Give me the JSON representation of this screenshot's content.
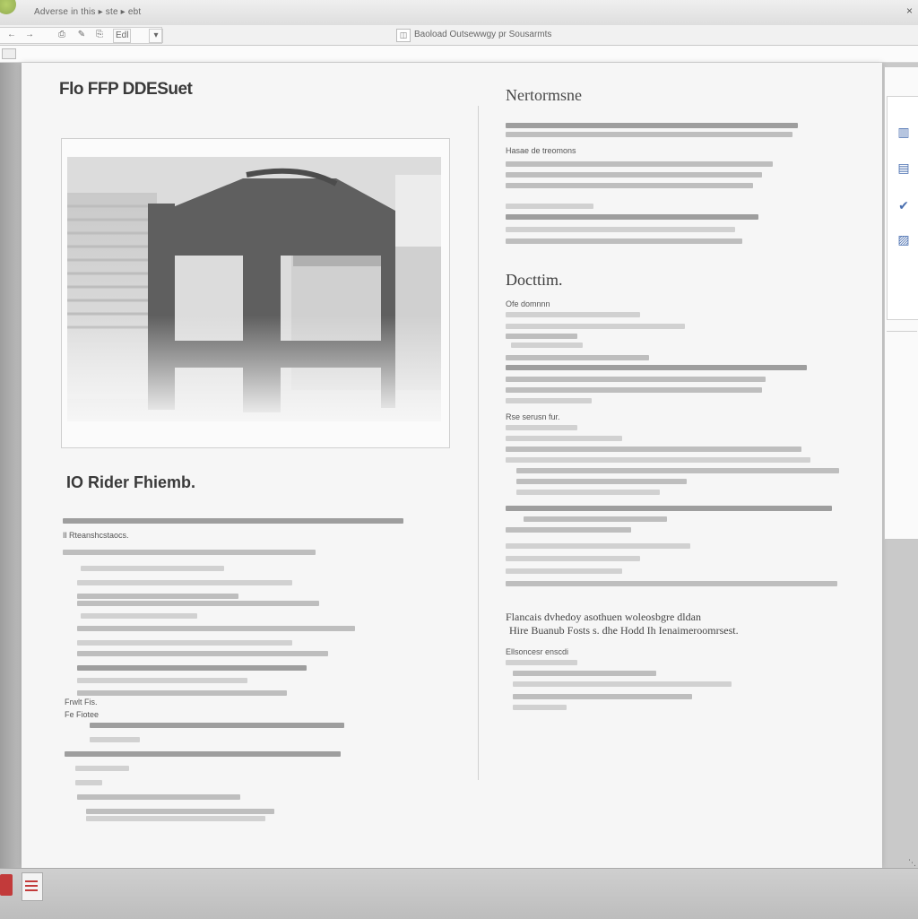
{
  "window": {
    "title": "Adverse in this    ▸ ste  ▸ ebt",
    "address": "Baoload Outsewwgy pr Sousarmts",
    "address_icon": "◫",
    "close_glyph": "×",
    "toolbar": [
      "←",
      "→",
      "⎙",
      "✎",
      "⎘",
      "Edl",
      "▾"
    ]
  },
  "document": {
    "title": "Flo FFP DDESuet",
    "section_left": "IO Rider Fhiemb.",
    "right_heading_1": "Nertormsne",
    "right_heading_2": "Docttim.",
    "right_heading_3_line1": "Flancais dvhedoy asothuen woleosbgre dldan",
    "right_heading_3_line2": "Hire Buanub Fosts s. dhe Hodd Ih Ienaimeroomrsest.",
    "right_labels": {
      "sub1": "Hasae de treomons",
      "sub2": "Ofe domnnn",
      "sub3": "Rse serusn fur.",
      "sub4": "Ellsoncesr enscdi"
    },
    "left_labels": {
      "l1": "Il Rteanshcstaocs.",
      "l2": "Frwlt Fis.",
      "l3": "Fe  Fiotee"
    }
  },
  "side_panel": {
    "icons": [
      "document-chart-icon",
      "image-icon",
      "check-chart-icon",
      "picture-icon"
    ],
    "glyphs": [
      "▥",
      "▤",
      "✔",
      "▨"
    ]
  },
  "status": {
    "grip": "⋱"
  }
}
